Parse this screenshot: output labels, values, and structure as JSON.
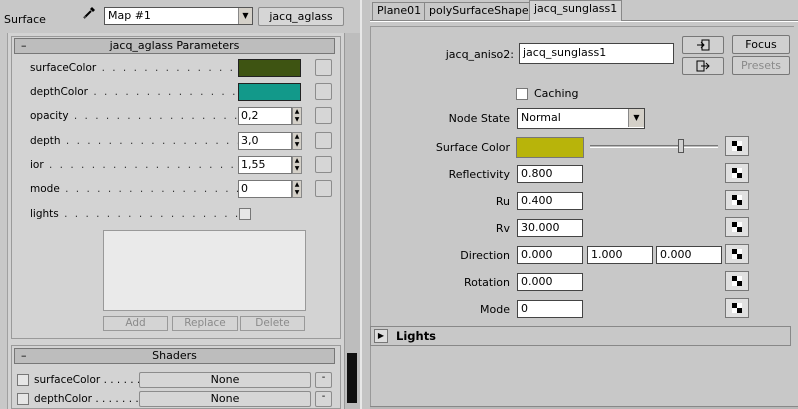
{
  "left": {
    "surface_label": "Surface",
    "map_select": "Map #1",
    "material_name": "jacq_aglass",
    "params_rollout": {
      "title": "jacq_aglass Parameters",
      "collapse_glyph": "–",
      "params": [
        {
          "label": "surfaceColor",
          "kind": "color",
          "color": "#3e5412"
        },
        {
          "label": "depthColor",
          "kind": "color",
          "color": "#12998a"
        },
        {
          "label": "opacity",
          "kind": "spin",
          "value": "0,2"
        },
        {
          "label": "depth",
          "kind": "spin",
          "value": "3,0"
        },
        {
          "label": "ior",
          "kind": "spin",
          "value": "1,55"
        },
        {
          "label": "mode",
          "kind": "spin",
          "value": "0"
        },
        {
          "label": "lights",
          "kind": "check"
        }
      ],
      "list_buttons": {
        "add": "Add",
        "replace": "Replace",
        "delete": "Delete"
      }
    },
    "shaders_rollout": {
      "title": "Shaders",
      "collapse_glyph": "–",
      "rows": [
        {
          "label": "surfaceColor",
          "button": "None",
          "small": "-"
        },
        {
          "label": "depthColor",
          "button": "None",
          "small": "-"
        }
      ]
    }
  },
  "right": {
    "tabs": [
      "Plane01",
      "polySurfaceShape1",
      "jacq_sunglass1"
    ],
    "active_tab": "jacq_sunglass1",
    "node_label": "jacq_aniso2:",
    "node_name": "jacq_sunglass1",
    "focus_label": "Focus",
    "presets_label": "Presets",
    "caching_label": "Caching",
    "node_state_label": "Node State",
    "node_state_value": "Normal",
    "surface_color_label": "Surface Color",
    "surface_color": "#b8b40a",
    "attrs": [
      {
        "label": "Reflectivity",
        "values": [
          "0.800"
        ]
      },
      {
        "label": "Ru",
        "values": [
          "0.400"
        ]
      },
      {
        "label": "Rv",
        "values": [
          "30.000"
        ]
      },
      {
        "label": "Direction",
        "values": [
          "0.000",
          "1.000",
          "0.000"
        ]
      },
      {
        "label": "Rotation",
        "values": [
          "0.000"
        ]
      },
      {
        "label": "Mode",
        "values": [
          "0"
        ]
      }
    ],
    "lights_label": "Lights"
  }
}
